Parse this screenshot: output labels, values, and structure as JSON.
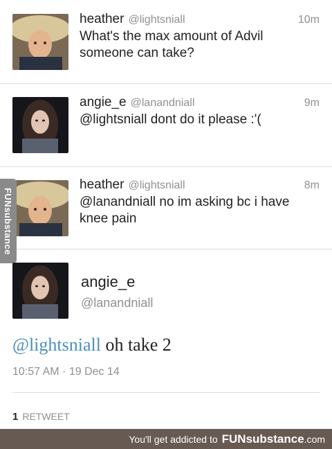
{
  "tweets": [
    {
      "name": "heather",
      "handle": "@lightsniall",
      "time": "10m",
      "lines": [
        "What's the max amount of Advil",
        "someone can take?"
      ],
      "avatar": "avatar-heather"
    },
    {
      "name": "angie_e",
      "handle": "@lanandniall",
      "time": "9m",
      "lines": [
        "@lightsniall dont do it please :'("
      ],
      "avatar": "avatar-angie"
    },
    {
      "name": "heather",
      "handle": "@lightsniall",
      "time": "8m",
      "lines": [
        "@lanandniall no im asking bc i have",
        "knee pain"
      ],
      "avatar": "avatar-heather"
    }
  ],
  "detail": {
    "name": "angie_e",
    "handle": "@lanandniall",
    "mention": "@lightsniall",
    "text": " oh take 2",
    "timestamp": "10:57 AM · 19 Dec 14",
    "retweet_count": "1",
    "retweet_label": "RETWEET",
    "avatar": "avatar-angie"
  },
  "watermark": {
    "side_tab": "FUNsubstance",
    "footer_text": "You'll get addicted to",
    "footer_brand": "FUNsubstance",
    "footer_domain": ".com"
  },
  "colors": {
    "mention": "#4a90b8",
    "muted": "#8f8f8f",
    "footer_bg": "#675a52",
    "divider": "#dcdcdc"
  }
}
